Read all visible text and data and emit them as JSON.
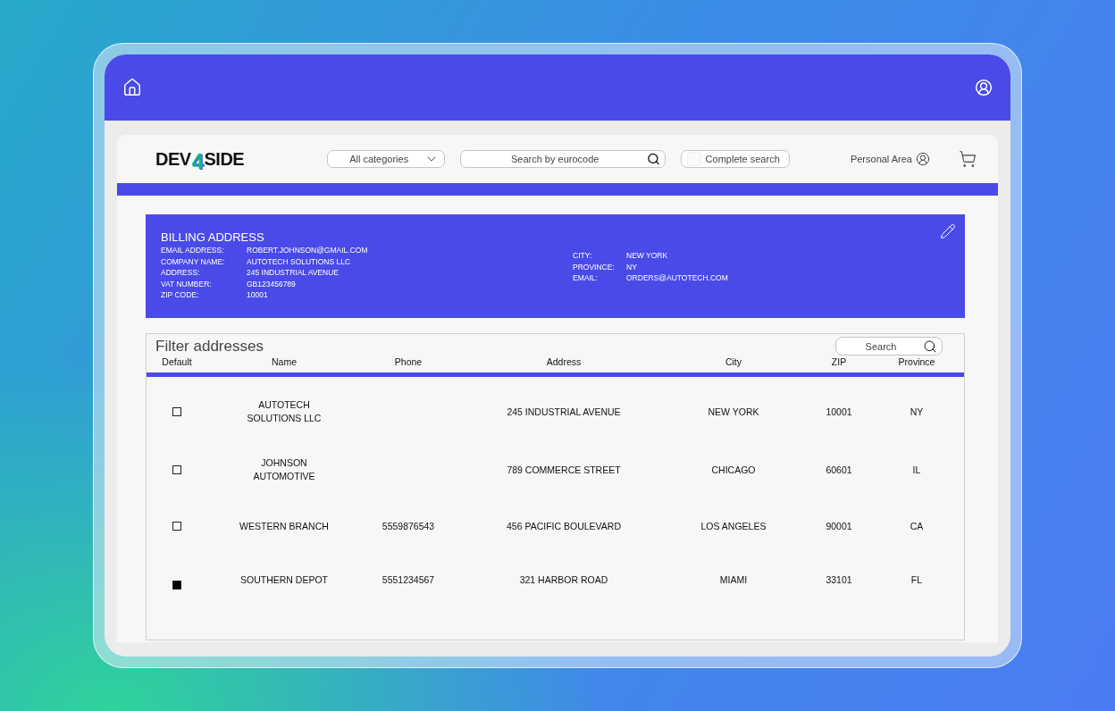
{
  "header": {
    "logo": [
      "DEV",
      "4",
      "SIDE"
    ],
    "category_select": "All categories",
    "search": {
      "placeholder": "Search by eurocode"
    },
    "complete_search": {
      "label": "Complete search",
      "checked": false
    },
    "personal_area": "Personal Area"
  },
  "billing": {
    "title": "BILLING ADDRESS",
    "left": [
      {
        "label": "EMAIL ADDRESS:",
        "value": "ROBERT.JOHNSON@GMAIL.COM"
      },
      {
        "label": "COMPANY NAME:",
        "value": "AUTOTECH SOLUTIONS LLC"
      },
      {
        "label": "ADDRESS:",
        "value": "245 INDUSTRIAL AVENUE"
      },
      {
        "label": "VAT NUMBER:",
        "value": "GB123456789"
      },
      {
        "label": "ZIP CODE:",
        "value": "10001"
      }
    ],
    "right": [
      {
        "label": "CITY:",
        "value": "NEW YORK"
      },
      {
        "label": "PROVINCE:",
        "value": "NY"
      },
      {
        "label": "EMAIL:",
        "value": "ORDERS@AUTOTECH.COM"
      }
    ]
  },
  "addresses": {
    "title": "Filter addresses",
    "search": {
      "placeholder": "Search"
    },
    "columns": [
      "Default",
      "Name",
      "Phone",
      "Address",
      "City",
      "ZIP",
      "Province"
    ],
    "rows": [
      {
        "default": false,
        "name": "AUTOTECH SOLUTIONS LLC",
        "address": "245 INDUSTRIAL AVENUE",
        "city": "NEW YORK",
        "zip": "10001",
        "province": "NY"
      },
      {
        "default": false,
        "name": "JOHNSON AUTOMOTIVE",
        "address": "789 COMMERCE STREET",
        "city": "CHICAGO",
        "zip": "60601",
        "province": "IL"
      },
      {
        "default": false,
        "name": "WESTERN BRANCH",
        "phone": "5559876543",
        "address": "456 PACIFIC BOULEVARD",
        "city": "LOS ANGELES",
        "zip": "90001",
        "province": "CA"
      },
      {
        "default": true,
        "name": "SOUTHERN DEPOT",
        "phone": "5551234567",
        "address": "321 HARBOR ROAD",
        "city": "MIAMI",
        "zip": "33101",
        "province": "FL"
      }
    ]
  }
}
